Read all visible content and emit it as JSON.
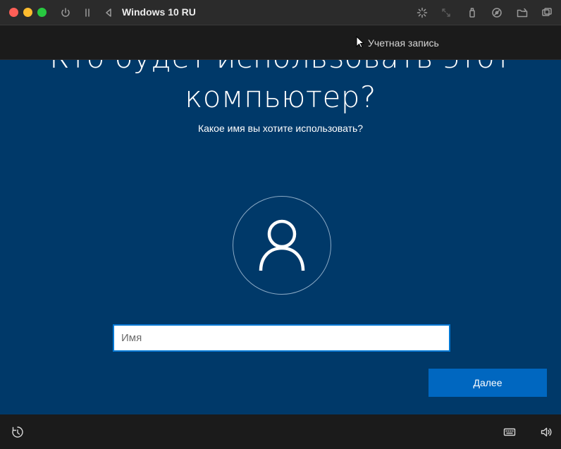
{
  "window": {
    "title": "Windows 10 RU"
  },
  "oobe": {
    "section_title": "Учетная запись",
    "heading_line1": "Кто будет использовать этот",
    "heading_line2": "компьютер?",
    "subheading": "Какое имя вы хотите использовать?",
    "name_placeholder": "Имя",
    "name_value": "",
    "next_label": "Далее"
  },
  "icons": {
    "titlebar_left": [
      "power-icon",
      "pause-icon",
      "back-icon"
    ],
    "titlebar_right": [
      "spinner-icon",
      "resize-icon",
      "usb-icon",
      "disc-icon",
      "folder-share-icon",
      "windows-icon"
    ],
    "bottom_left": "ease-of-access-icon",
    "bottom_right": [
      "keyboard-icon",
      "volume-icon"
    ]
  },
  "colors": {
    "screen_bg": "#003969",
    "accent": "#0067c0",
    "input_border": "#0078d4"
  }
}
